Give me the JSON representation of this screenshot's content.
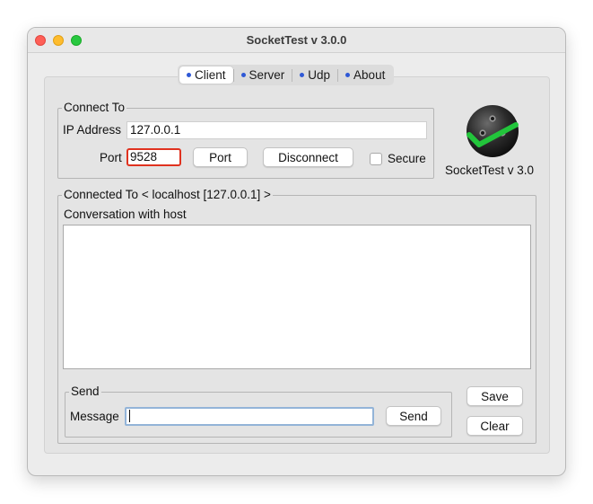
{
  "window": {
    "title": "SocketTest v 3.0.0"
  },
  "tabs": [
    {
      "label": "Client",
      "active": true
    },
    {
      "label": "Server",
      "active": false
    },
    {
      "label": "Udp",
      "active": false
    },
    {
      "label": "About",
      "active": false
    }
  ],
  "connect": {
    "legend": "Connect To",
    "ip_label": "IP Address",
    "ip_value": "127.0.0.1",
    "port_label": "Port",
    "port_value": "9528",
    "port_button": "Port",
    "disconnect_button": "Disconnect",
    "secure_label": "Secure",
    "secure_checked": false
  },
  "brand": {
    "version_text": "SocketTest v 3.0",
    "logo_icon": "socket-plug-check-icon"
  },
  "connected": {
    "legend": "Connected To <  localhost [127.0.0.1]  >",
    "conversation_label": "Conversation with host",
    "conversation_text": ""
  },
  "send": {
    "legend": "Send",
    "message_label": "Message",
    "message_value": "",
    "send_button": "Send"
  },
  "actions": {
    "save_button": "Save",
    "clear_button": "Clear"
  },
  "colors": {
    "tab_dot": "#2f59d6",
    "port_highlight": "#e0321f",
    "check_green": "#22c53b",
    "focus_ring": "#93b4d8"
  }
}
